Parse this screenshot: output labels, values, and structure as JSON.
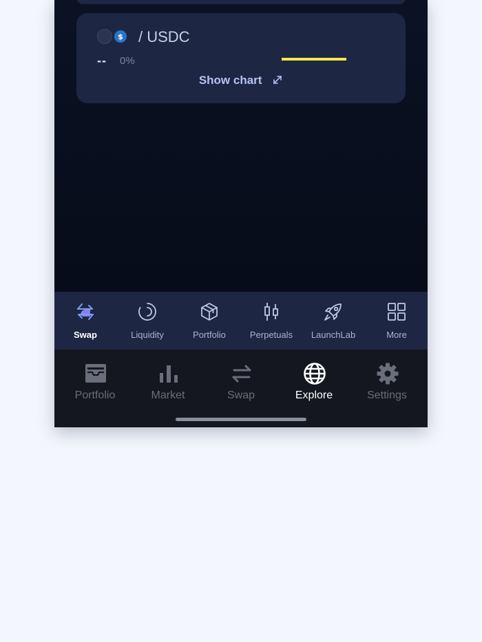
{
  "pair_card": {
    "pair": "/ USDC",
    "price": "--",
    "change": "0%",
    "show_chart": "Show chart",
    "token_b_symbol": "$"
  },
  "sub_nav": {
    "items": [
      {
        "label": "Swap",
        "icon": "swap-arrows-icon"
      },
      {
        "label": "Liquidity",
        "icon": "liquidity-ring-icon"
      },
      {
        "label": "Portfolio",
        "icon": "cube-icon"
      },
      {
        "label": "Perpetuals",
        "icon": "candlestick-icon"
      },
      {
        "label": "LaunchLab",
        "icon": "rocket-icon"
      },
      {
        "label": "More",
        "icon": "grid-icon"
      }
    ],
    "active": "Swap"
  },
  "bottom_nav": {
    "items": [
      {
        "label": "Portfolio",
        "icon": "wallet-icon"
      },
      {
        "label": "Market",
        "icon": "bar-chart-icon"
      },
      {
        "label": "Swap",
        "icon": "swap-arrows-icon"
      },
      {
        "label": "Explore",
        "icon": "globe-icon"
      },
      {
        "label": "Settings",
        "icon": "gear-icon"
      }
    ],
    "active": "Explore"
  },
  "colors": {
    "accent_underline": "#f5e94a",
    "card_bg": "#1d2743",
    "active_icon": "#8b7cf6",
    "usdc_blue": "#2775ca"
  }
}
